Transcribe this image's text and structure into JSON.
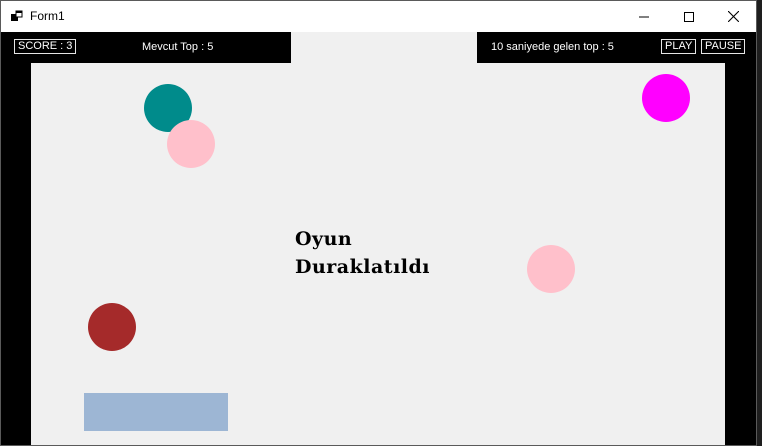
{
  "window": {
    "title": "Form1"
  },
  "hud": {
    "score": "SCORE : 3",
    "current_balls": "Mevcut Top : 5",
    "incoming_balls": "10 saniyede gelen top : 5",
    "play_label": "PLAY",
    "pause_label": "PAUSE"
  },
  "game": {
    "paused_line1": "Oyun",
    "paused_line2": "Duraklatıldı",
    "balls": [
      {
        "color": "#008b8b",
        "name": "teal"
      },
      {
        "color": "#ffc0cb",
        "name": "pink"
      },
      {
        "color": "#ff00ff",
        "name": "magenta"
      },
      {
        "color": "#ffc0cb",
        "name": "pink"
      },
      {
        "color": "#a52a2a",
        "name": "brown"
      }
    ],
    "paddle_color": "#9db6d4",
    "field_color": "#f0f0f0"
  }
}
